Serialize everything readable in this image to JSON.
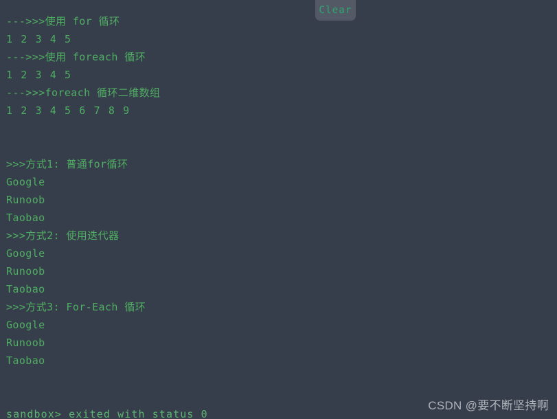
{
  "colors": {
    "background": "#373e4b",
    "output_green": "#4fae62",
    "status_green": "#5bb571",
    "button_bg": "#535a66",
    "button_text": "#2aa971",
    "watermark": "#c9ccd2"
  },
  "toolbar": {
    "clear_label": "Clear"
  },
  "console": {
    "lines": [
      {
        "text": "--->>>使用 for 循环",
        "kind": "text"
      },
      {
        "text": "1 2 3 4 5",
        "kind": "nums"
      },
      {
        "text": "--->>>使用 foreach 循环",
        "kind": "text"
      },
      {
        "text": "1 2 3 4 5",
        "kind": "nums"
      },
      {
        "text": "--->>>foreach 循环二维数组",
        "kind": "text"
      },
      {
        "text": "1 2 3 4 5 6 7 8 9",
        "kind": "nums"
      },
      {
        "text": "",
        "kind": "blank"
      },
      {
        "text": "",
        "kind": "blank"
      },
      {
        "text": ">>>方式1: 普通for循环",
        "kind": "text"
      },
      {
        "text": "Google",
        "kind": "text"
      },
      {
        "text": "Runoob",
        "kind": "text"
      },
      {
        "text": "Taobao",
        "kind": "text"
      },
      {
        "text": ">>>方式2: 使用迭代器",
        "kind": "text"
      },
      {
        "text": "Google",
        "kind": "text"
      },
      {
        "text": "Runoob",
        "kind": "text"
      },
      {
        "text": "Taobao",
        "kind": "text"
      },
      {
        "text": ">>>方式3: For-Each 循环",
        "kind": "text"
      },
      {
        "text": "Google",
        "kind": "text"
      },
      {
        "text": "Runoob",
        "kind": "text"
      },
      {
        "text": "Taobao",
        "kind": "text"
      },
      {
        "text": "",
        "kind": "blank"
      },
      {
        "text": "",
        "kind": "blank"
      },
      {
        "text": "sandbox> exited with status 0",
        "kind": "status"
      }
    ]
  },
  "watermark": {
    "text": "CSDN @要不断坚持啊"
  }
}
